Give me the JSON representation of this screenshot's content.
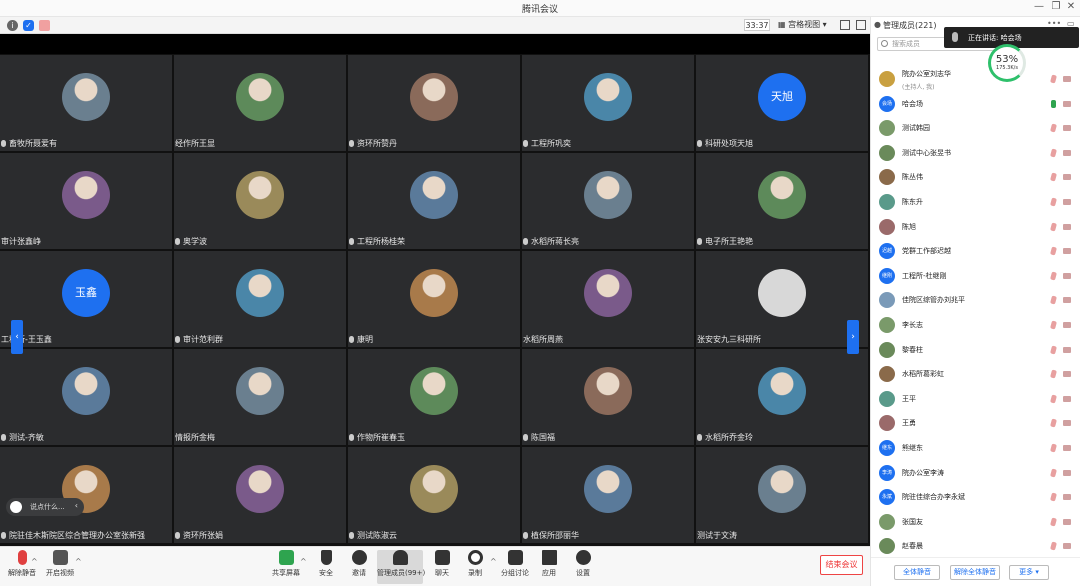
{
  "window": {
    "title": "腾讯会议"
  },
  "toolbar": {
    "timer": "33:37",
    "view_label": "宫格视图"
  },
  "speaking": {
    "label": "正在讲话: 哈会场"
  },
  "network": {
    "percent": "53%",
    "speed": "175.3K/s"
  },
  "tiles": [
    {
      "name": "畜牧所聂爱有",
      "avatar": "photo",
      "mic": true
    },
    {
      "name": "经作所王显",
      "avatar": "photo",
      "mic": false
    },
    {
      "name": "资环所赞丹",
      "avatar": "photo",
      "mic": true
    },
    {
      "name": "工程所巩奕",
      "avatar": "photo",
      "mic": true
    },
    {
      "name": "科研处项天旭",
      "avatar": "text",
      "text": "天旭",
      "mic": true
    },
    {
      "name": "审计张鑫峥",
      "avatar": "photo",
      "mic": false
    },
    {
      "name": "奥学波",
      "avatar": "photo",
      "mic": true
    },
    {
      "name": "工程所杨桂荣",
      "avatar": "photo",
      "mic": true
    },
    {
      "name": "水稻所蒋长亮",
      "avatar": "photo",
      "mic": true
    },
    {
      "name": "电子所王艳艳",
      "avatar": "photo",
      "mic": true
    },
    {
      "name": "工程所-王玉鑫",
      "avatar": "text",
      "text": "玉鑫",
      "mic": false
    },
    {
      "name": "审计范利群",
      "avatar": "photo",
      "mic": true
    },
    {
      "name": "康明",
      "avatar": "photo",
      "mic": true
    },
    {
      "name": "水稻所周燕",
      "avatar": "photo",
      "mic": false
    },
    {
      "name": "张安安九三科研所",
      "avatar": "default",
      "mic": false
    },
    {
      "name": "测试-齐敏",
      "avatar": "photo",
      "mic": true
    },
    {
      "name": "情报所金梅",
      "avatar": "photo",
      "mic": false
    },
    {
      "name": "作物所崔春玉",
      "avatar": "photo",
      "mic": true
    },
    {
      "name": "陈国福",
      "avatar": "photo",
      "mic": true
    },
    {
      "name": "水稻所乔金玲",
      "avatar": "photo",
      "mic": true
    },
    {
      "name": "院驻佳木斯院区综合管理办公室张新强",
      "avatar": "photo",
      "mic": true
    },
    {
      "name": "资环所张娟",
      "avatar": "photo",
      "mic": true
    },
    {
      "name": "测试陈淑云",
      "avatar": "photo",
      "mic": true
    },
    {
      "name": "植保所邵丽华",
      "avatar": "photo",
      "mic": true
    },
    {
      "name": "测试于文涛",
      "avatar": "photo",
      "mic": false
    }
  ],
  "chat": {
    "placeholder": "说点什么...",
    "collapse": "‹"
  },
  "bottombar": {
    "mute": "解除静音",
    "video": "开启视频",
    "share": "共享屏幕",
    "security": "安全",
    "invite": "邀请",
    "members": "管理成员(99+)",
    "chat": "聊天",
    "record": "录制",
    "breakout": "分组讨论",
    "apps": "应用",
    "settings": "设置",
    "end": "结束会议"
  },
  "panel": {
    "title": "管理成员(221)",
    "search_placeholder": "搜索成员",
    "members": [
      {
        "name": "院办公室刘志华",
        "sub": "(主持人, 我)",
        "avatar": "photo",
        "mic_on": false
      },
      {
        "name": "哈会场",
        "avatar": "text",
        "text": "会场",
        "mic_on": true
      },
      {
        "name": "测试韩园",
        "avatar": "photo",
        "mic_on": false
      },
      {
        "name": "测试中心张昱书",
        "avatar": "photo",
        "mic_on": false
      },
      {
        "name": "陈丛伟",
        "avatar": "photo",
        "mic_on": false
      },
      {
        "name": "陈东升",
        "avatar": "photo",
        "mic_on": false
      },
      {
        "name": "陈旭",
        "avatar": "photo",
        "mic_on": false
      },
      {
        "name": "党群工作部迟越",
        "avatar": "text",
        "text": "迟越",
        "mic_on": false
      },
      {
        "name": "工程所-杜继刚",
        "avatar": "text",
        "text": "继刚",
        "mic_on": false
      },
      {
        "name": "佳院区综管办刘兆平",
        "avatar": "photo",
        "mic_on": false
      },
      {
        "name": "李长志",
        "avatar": "photo",
        "mic_on": false
      },
      {
        "name": "黎春柱",
        "avatar": "photo",
        "mic_on": false
      },
      {
        "name": "水稻所葛彩虹",
        "avatar": "photo",
        "mic_on": false
      },
      {
        "name": "王平",
        "avatar": "photo",
        "mic_on": false
      },
      {
        "name": "王勇",
        "avatar": "photo",
        "mic_on": false
      },
      {
        "name": "熊继东",
        "avatar": "text",
        "text": "继东",
        "mic_on": false
      },
      {
        "name": "院办公室李涛",
        "avatar": "text",
        "text": "李涛",
        "mic_on": false
      },
      {
        "name": "院驻佳综合办李永斌",
        "avatar": "text",
        "text": "永斌",
        "mic_on": false
      },
      {
        "name": "张国友",
        "avatar": "photo",
        "mic_on": false
      },
      {
        "name": "赵春晨",
        "avatar": "photo",
        "mic_on": false
      }
    ],
    "mute_all": "全体静音",
    "unmute_all": "解除全体静音",
    "more": "更多 ▾"
  },
  "colors": {
    "accent": "#1e70f0",
    "tile_bg": "#2b2c2e",
    "end_red": "#e33333",
    "ok_green": "#2ea44f"
  }
}
